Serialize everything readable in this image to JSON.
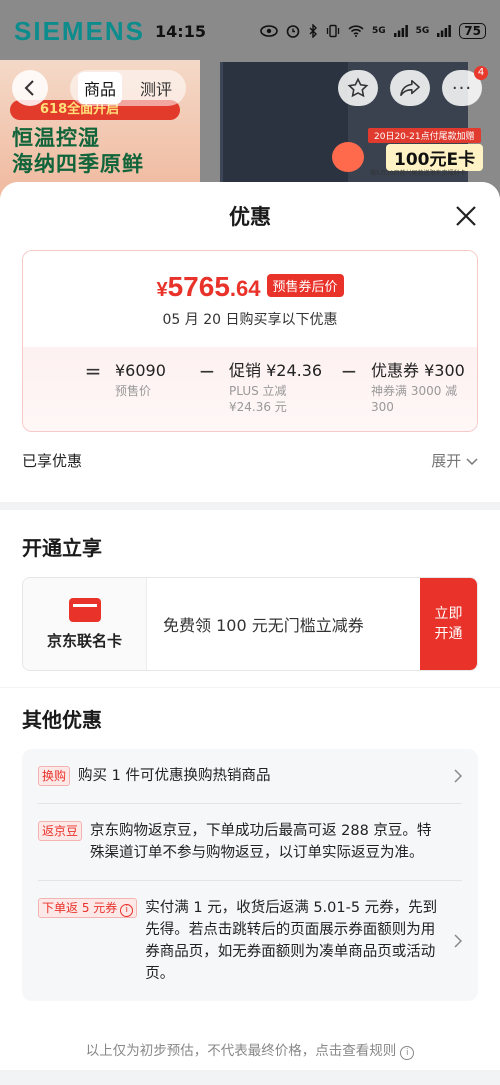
{
  "status_bar": {
    "brand": "SIEMENS",
    "time": "14:15",
    "signal1": "5G",
    "signal2": "5G",
    "battery": "75"
  },
  "nav": {
    "tabs": [
      "商品",
      "测评"
    ],
    "back_icon": "chevron-left-icon",
    "cart_badge": "4"
  },
  "background_promo": {
    "banner": "618全面开启",
    "line1": "恒温控湿",
    "line2": "海纳四季原鲜",
    "coupon_top": "20日20-21点付尾款加赠",
    "coupon_main": "100元E卡",
    "coupon_note": "限5月30日前付尾款送限东京福利卡"
  },
  "sheet": {
    "title": "优惠",
    "price": {
      "symbol": "¥",
      "integer": "5765",
      "decimal": ".64",
      "tag": "预售券后价",
      "subtitle": "05 月 20 日购买享以下优惠"
    },
    "calc": [
      {
        "op": "=",
        "value": "¥6090",
        "desc": "预售价"
      },
      {
        "op": "−",
        "value": "促销 ¥24.36",
        "desc": "PLUS 立减 ¥24.36 元"
      },
      {
        "op": "−",
        "value": "优惠券 ¥300",
        "desc": "神券满 3000 减 300"
      }
    ],
    "enjoyed_label": "已享优惠",
    "expand_label": "展开",
    "open_section": {
      "title": "开通立享",
      "card_name": "京东联名卡",
      "card_desc": "免费领 100 元无门槛立减券",
      "button_line1": "立即",
      "button_line2": "开通"
    },
    "other_section": {
      "title": "其他优惠",
      "offers": [
        {
          "tag": "换购",
          "text": "购买 1 件可优惠换购热销商品"
        },
        {
          "tag": "返京豆",
          "text": "京东购物返京豆，下单成功后最高可返 288 京豆。特殊渠道订单不参与购物返豆，以订单实际返豆为准。"
        },
        {
          "tag": "下单返 5 元券",
          "text": "实付满 1 元，收货后返满 5.01-5 元券，先到先得。若点击跳转后的页面展示券面额则为用券商品页，如无券面额则为凑单商品页或活动页。"
        }
      ]
    },
    "footer": "以上仅为初步预估，不代表最终价格，点击查看规则"
  },
  "colors": {
    "accent": "#e8322a",
    "brand_teal": "#0c8c8c"
  }
}
